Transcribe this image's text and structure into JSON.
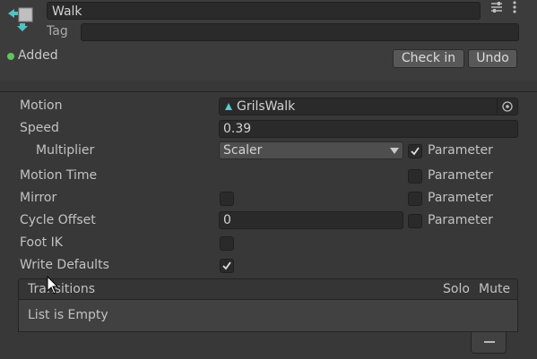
{
  "header": {
    "name": "Walk",
    "tag_label": "Tag",
    "tag_value": "",
    "added_label": "Added",
    "check_in_label": "Check in",
    "undo_label": "Undo"
  },
  "properties": {
    "motion": {
      "label": "Motion",
      "value": "GrilsWalk"
    },
    "speed": {
      "label": "Speed",
      "value": "0.39"
    },
    "multiplier": {
      "label": "Multiplier",
      "value": "Scaler",
      "parameter_checked": true
    },
    "motion_time": {
      "label": "Motion Time",
      "parameter_checked": false
    },
    "mirror": {
      "label": "Mirror",
      "checked": false,
      "parameter_checked": false
    },
    "cycle_offset": {
      "label": "Cycle Offset",
      "value": "0",
      "parameter_checked": false
    },
    "foot_ik": {
      "label": "Foot IK",
      "checked": false
    },
    "write_defaults": {
      "label": "Write Defaults",
      "checked": true
    },
    "parameter_label": "Parameter"
  },
  "transitions": {
    "title": "Transitions",
    "solo": "Solo",
    "mute": "Mute",
    "empty_text": "List is Empty"
  },
  "colors": {
    "background": "#383838",
    "field": "#2a2a2a",
    "accent_added": "#5fc35f",
    "motion_clip": "#5fc8c8"
  }
}
